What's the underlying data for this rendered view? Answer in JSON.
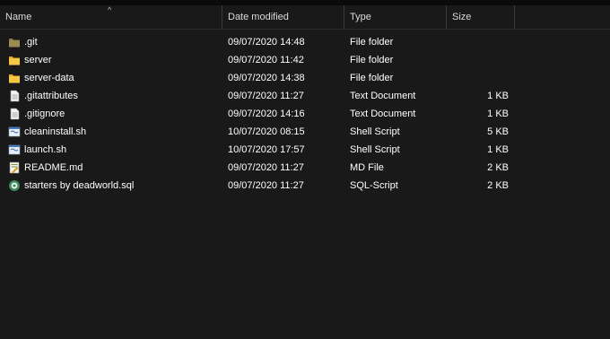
{
  "columns": {
    "name": "Name",
    "date_modified": "Date modified",
    "type": "Type",
    "size": "Size"
  },
  "sort_indicator": "^",
  "files": [
    {
      "name": ".git",
      "date": "09/07/2020 14:48",
      "type": "File folder",
      "size": "",
      "icon": "folder-dim-icon"
    },
    {
      "name": "server",
      "date": "09/07/2020 11:42",
      "type": "File folder",
      "size": "",
      "icon": "folder-icon"
    },
    {
      "name": "server-data",
      "date": "09/07/2020 14:38",
      "type": "File folder",
      "size": "",
      "icon": "folder-icon"
    },
    {
      "name": ".gitattributes",
      "date": "09/07/2020 11:27",
      "type": "Text Document",
      "size": "1 KB",
      "icon": "text-document-icon"
    },
    {
      "name": ".gitignore",
      "date": "09/07/2020 14:16",
      "type": "Text Document",
      "size": "1 KB",
      "icon": "text-document-icon"
    },
    {
      "name": "cleaninstall.sh",
      "date": "10/07/2020 08:15",
      "type": "Shell Script",
      "size": "5 KB",
      "icon": "shell-script-icon"
    },
    {
      "name": "launch.sh",
      "date": "10/07/2020 17:57",
      "type": "Shell Script",
      "size": "1 KB",
      "icon": "shell-script-icon"
    },
    {
      "name": "README.md",
      "date": "09/07/2020 11:27",
      "type": "MD File",
      "size": "2 KB",
      "icon": "markdown-file-icon"
    },
    {
      "name": "starters by deadworld.sql",
      "date": "09/07/2020 11:27",
      "type": "SQL-Script",
      "size": "2 KB",
      "icon": "sql-script-icon"
    }
  ],
  "colors": {
    "background": "#191919",
    "folder": "#f6c744",
    "folder_dim": "#8a7a4a",
    "text": "#ffffff"
  }
}
